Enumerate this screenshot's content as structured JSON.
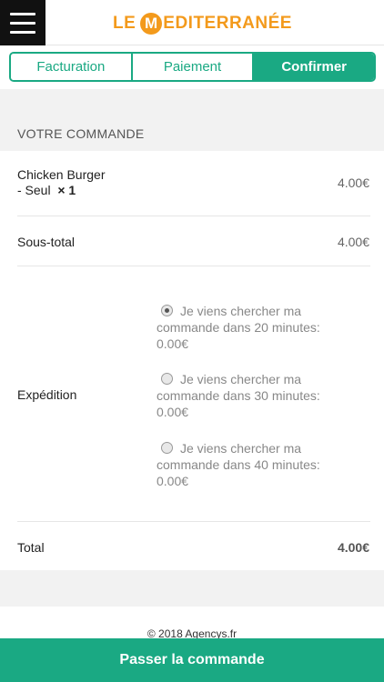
{
  "header": {
    "logo_left": "LE",
    "logo_m": "M",
    "logo_right": "EDITERRANÉE"
  },
  "tabs": [
    {
      "label": "Facturation"
    },
    {
      "label": "Paiement"
    },
    {
      "label": "Confirmer"
    }
  ],
  "order": {
    "section_title": "VOTRE COMMANDE",
    "item": {
      "name_line1": "Chicken Burger",
      "name_line2": "- Seul",
      "quantity": "× 1",
      "price": "4.00€"
    },
    "subtotal_label": "Sous-total",
    "subtotal_value": "4.00€",
    "shipping_label": "Expédition",
    "shipping_options": [
      {
        "line1": "Je viens chercher ma",
        "line2": "commande dans 20 minutes:",
        "line3": "0.00€",
        "checked": true
      },
      {
        "line1": "Je viens chercher ma",
        "line2": "commande dans 30 minutes:",
        "line3": "0.00€",
        "checked": false
      },
      {
        "line1": "Je viens chercher ma",
        "line2": "commande dans 40 minutes:",
        "line3": "0.00€",
        "checked": false
      }
    ],
    "total_label": "Total",
    "total_value": "4.00€"
  },
  "footer": {
    "copyright": "© 2018 Agencys.fr"
  },
  "cta": {
    "label": "Passer la commande"
  }
}
